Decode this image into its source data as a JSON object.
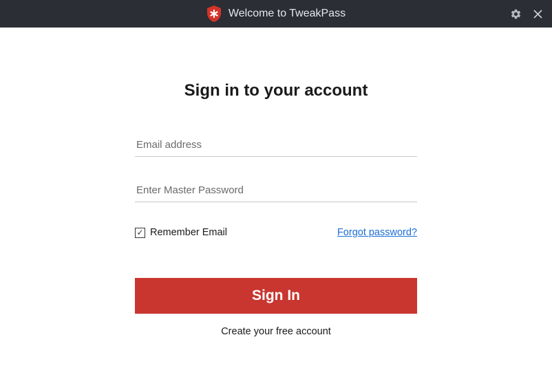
{
  "titlebar": {
    "title": "Welcome to TweakPass"
  },
  "signin": {
    "heading": "Sign in to your account",
    "email_placeholder": "Email address",
    "password_placeholder": "Enter Master Password",
    "remember_label": "Remember Email",
    "remember_checked": true,
    "forgot_password": "Forgot password?",
    "signin_button": "Sign In",
    "create_account": "Create your free account"
  },
  "colors": {
    "titlebar_bg": "#2b2f35",
    "button_bg": "#c8362f",
    "link": "#1a6dd6",
    "shield": "#d4332a"
  }
}
